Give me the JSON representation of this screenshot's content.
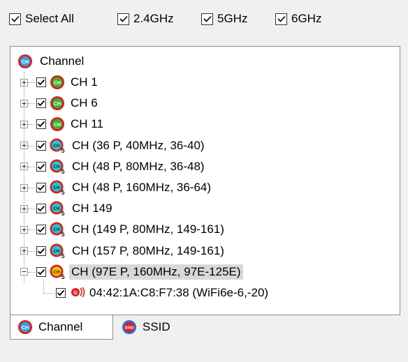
{
  "filters": [
    {
      "label": "Select All",
      "checked": true
    },
    {
      "label": "2.4GHz",
      "checked": true
    },
    {
      "label": "5GHz",
      "checked": true
    },
    {
      "label": "6GHz",
      "checked": true
    }
  ],
  "tree": {
    "root_label": "Channel",
    "channels": [
      {
        "label": "CH 1",
        "icon": "ch-2.4-icon"
      },
      {
        "label": "CH 6",
        "icon": "ch-2.4-icon"
      },
      {
        "label": "CH 11",
        "icon": "ch-2.4-icon"
      },
      {
        "label": "CH (36 P, 40MHz, 36-40)",
        "icon": "ch-5-icon"
      },
      {
        "label": "CH (48 P, 80MHz, 36-48)",
        "icon": "ch-5-icon"
      },
      {
        "label": "CH (48 P, 160MHz, 36-64)",
        "icon": "ch-5-icon"
      },
      {
        "label": "CH 149",
        "icon": "ch-5-icon"
      },
      {
        "label": "CH (149 P, 80MHz, 149-161)",
        "icon": "ch-5-icon"
      },
      {
        "label": "CH (157 P, 80MHz, 149-161)",
        "icon": "ch-5-icon"
      },
      {
        "label": "CH (97E P, 160MHz, 97E-125E)",
        "icon": "ch-6-icon"
      }
    ],
    "child_label": "04:42:1A:C8:F7:38 (WiFi6e-6,-20)"
  },
  "tabs": [
    {
      "label": "Channel",
      "icon": "channel-icon"
    },
    {
      "label": "SSID",
      "icon": "ssid-icon"
    }
  ],
  "colors": {
    "ch24": "#2fb52f",
    "ch5": "#20c8d8",
    "ch6": "#f2c200",
    "ring": "#e11b1b",
    "ssid_red": "#e02020"
  }
}
